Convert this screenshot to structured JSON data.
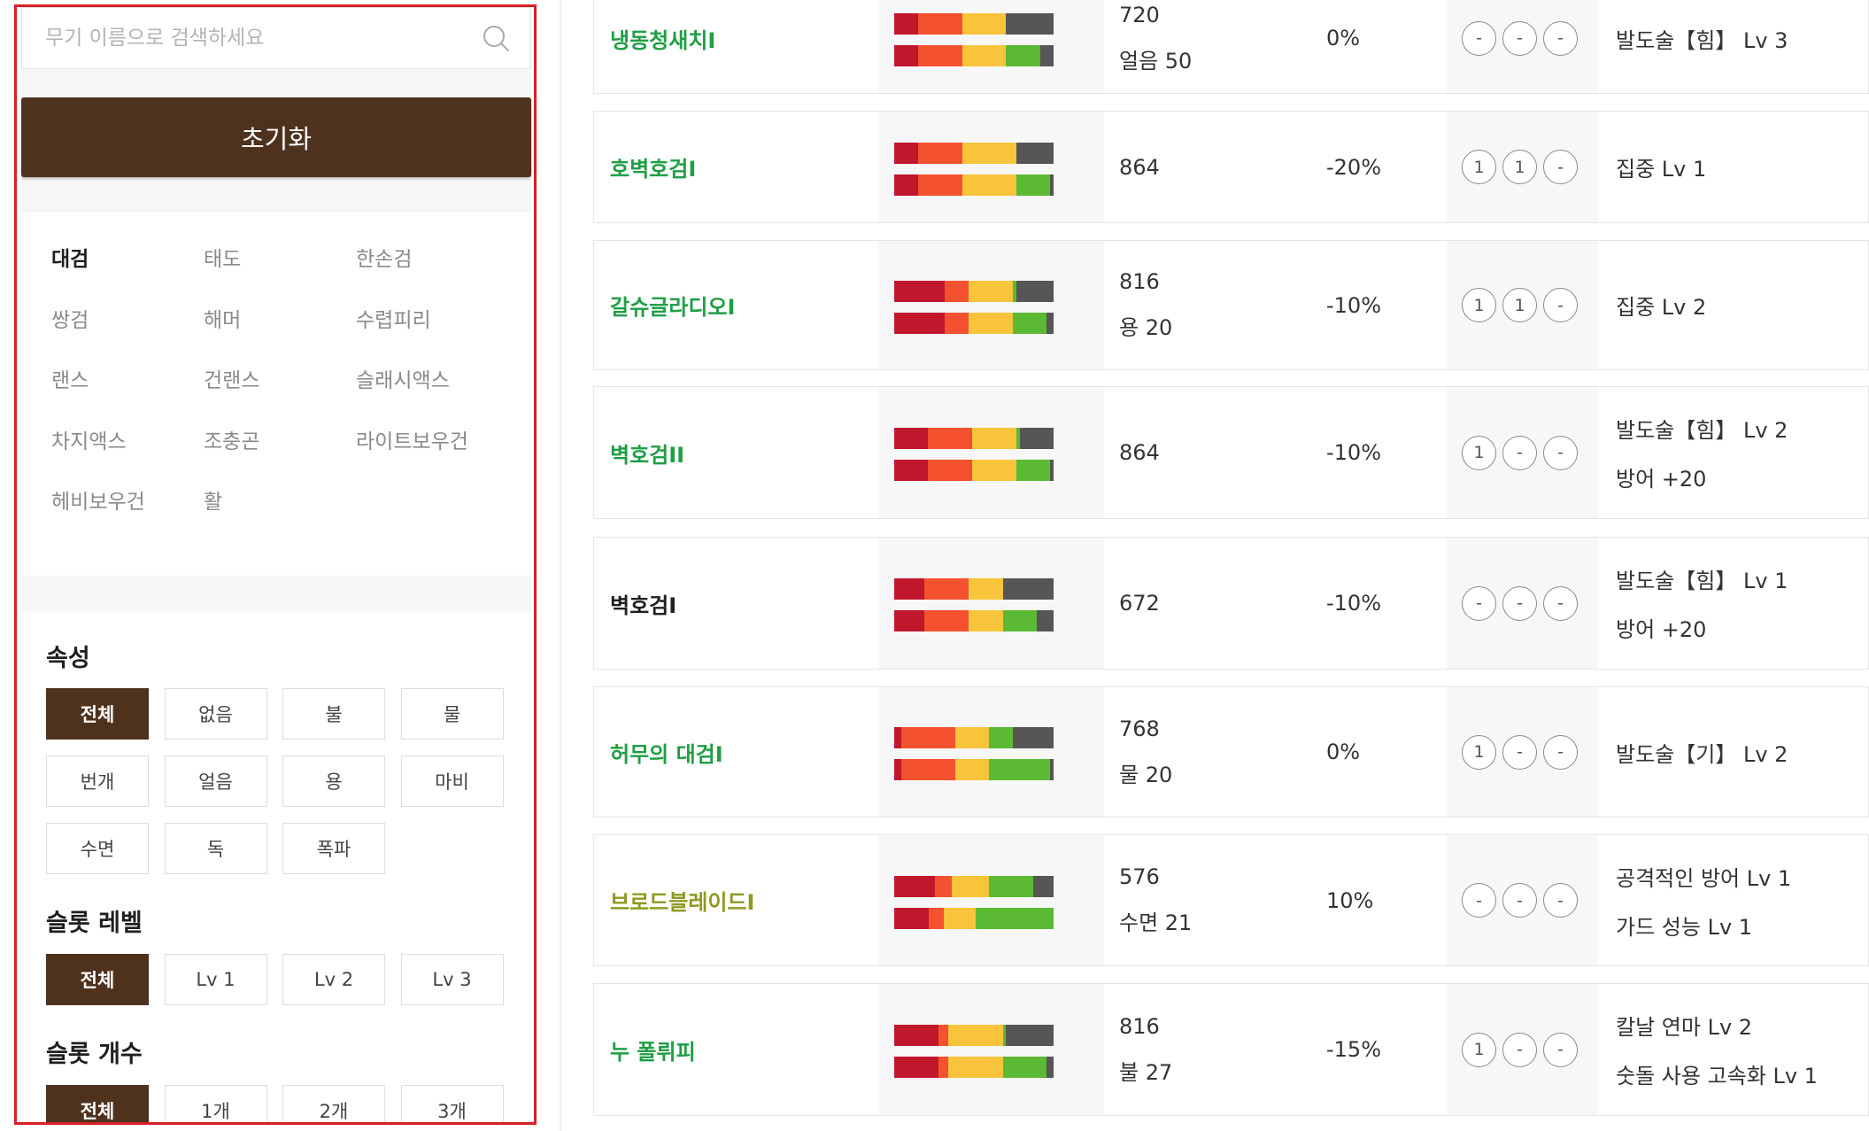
{
  "search": {
    "placeholder": "무기 이름으로 검색하세요",
    "value": ""
  },
  "reset_label": "초기화",
  "weapon_types": [
    {
      "label": "대검",
      "active": true
    },
    {
      "label": "태도",
      "active": false
    },
    {
      "label": "한손검",
      "active": false
    },
    {
      "label": "쌍검",
      "active": false
    },
    {
      "label": "해머",
      "active": false
    },
    {
      "label": "수렵피리",
      "active": false
    },
    {
      "label": "랜스",
      "active": false
    },
    {
      "label": "건랜스",
      "active": false
    },
    {
      "label": "슬래시액스",
      "active": false
    },
    {
      "label": "차지액스",
      "active": false
    },
    {
      "label": "조충곤",
      "active": false
    },
    {
      "label": "라이트보우건",
      "active": false
    },
    {
      "label": "헤비보우건",
      "active": false
    },
    {
      "label": "활",
      "active": false
    }
  ],
  "filters": {
    "element": {
      "title": "속성",
      "options": [
        "전체",
        "없음",
        "불",
        "물",
        "번개",
        "얼음",
        "용",
        "마비",
        "수면",
        "독",
        "폭파"
      ],
      "selected": "전체"
    },
    "slot_level": {
      "title": "슬롯 레벨",
      "options": [
        "전체",
        "Lv 1",
        "Lv 2",
        "Lv 3"
      ],
      "selected": "전체"
    },
    "slot_count": {
      "title": "슬롯 개수",
      "options": [
        "전체",
        "1개",
        "2개",
        "3개"
      ],
      "selected": "전체"
    }
  },
  "sharpness_colors": {
    "red": "#c0172c",
    "orange": "#f3512f",
    "yellow": "#f8c43c",
    "green": "#5cb933",
    "empty": "#565656"
  },
  "colors": {
    "accent_brown": "#4f321e",
    "name_green": "#1f9e45",
    "name_olive": "#8e9a20",
    "name_black": "#1f1f1f",
    "sidebar_border": "#d71f26"
  },
  "weapons": [
    {
      "name": "냉동청새치I",
      "name_color": "#1f9e45",
      "attack": "720",
      "element": "얼음 50",
      "affinity": "0%",
      "slots": [
        "-",
        "-",
        "-"
      ],
      "skills": [
        "발도술【힘】 Lv 3"
      ],
      "sharpness": [
        [
          7,
          13,
          13,
          0
        ],
        [
          7,
          13,
          13,
          10
        ]
      ]
    },
    {
      "name": "호벽호검I",
      "name_color": "#1f9e45",
      "attack": "864",
      "element": "",
      "affinity": "-20%",
      "slots": [
        "1",
        "1",
        "-"
      ],
      "skills": [
        "집중 Lv 1"
      ],
      "sharpness": [
        [
          7,
          13,
          16,
          0
        ],
        [
          7,
          13,
          16,
          10
        ]
      ]
    },
    {
      "name": "갈슈글라디오I",
      "name_color": "#1f9e45",
      "attack": "816",
      "element": "용 20",
      "affinity": "-10%",
      "slots": [
        "1",
        "1",
        "-"
      ],
      "skills": [
        "집중 Lv 2"
      ],
      "sharpness": [
        [
          15,
          7,
          13,
          1
        ],
        [
          15,
          7,
          13,
          10
        ]
      ]
    },
    {
      "name": "벽호검II",
      "name_color": "#1f9e45",
      "attack": "864",
      "element": "",
      "affinity": "-10%",
      "slots": [
        "1",
        "-",
        "-"
      ],
      "skills": [
        "발도술【힘】 Lv 2",
        "방어 +20"
      ],
      "sharpness": [
        [
          10,
          13,
          13,
          1
        ],
        [
          10,
          13,
          13,
          10
        ]
      ]
    },
    {
      "name": "벽호검I",
      "name_color": "#1f1f1f",
      "attack": "672",
      "element": "",
      "affinity": "-10%",
      "slots": [
        "-",
        "-",
        "-"
      ],
      "skills": [
        "발도술【힘】 Lv 1",
        "방어 +20"
      ],
      "sharpness": [
        [
          9,
          13,
          10,
          0
        ],
        [
          9,
          13,
          10,
          10
        ]
      ]
    },
    {
      "name": "허무의 대검I",
      "name_color": "#1f9e45",
      "attack": "768",
      "element": "물 20",
      "affinity": "0%",
      "slots": [
        "1",
        "-",
        "-"
      ],
      "skills": [
        "발도술【기】 Lv 2"
      ],
      "sharpness": [
        [
          2,
          16,
          10,
          7
        ],
        [
          2,
          16,
          10,
          18
        ]
      ]
    },
    {
      "name": "브로드블레이드I",
      "name_color": "#8e9a20",
      "attack": "576",
      "element": "수면 21",
      "affinity": "10%",
      "slots": [
        "-",
        "-",
        "-"
      ],
      "skills": [
        "공격적인 방어 Lv 1",
        "가드 성능 Lv 1"
      ],
      "sharpness": [
        [
          12,
          5,
          11,
          13
        ],
        [
          12,
          5,
          11,
          27
        ]
      ]
    },
    {
      "name": "누 폴뤼피",
      "name_color": "#1f9e45",
      "attack": "816",
      "element": "불 27",
      "affinity": "-15%",
      "slots": [
        "1",
        "-",
        "-"
      ],
      "skills": [
        "칼날 연마 Lv 2",
        "숫돌 사용 고속화 Lv 1"
      ],
      "sharpness": [
        [
          13,
          3,
          16,
          1
        ],
        [
          13,
          3,
          16,
          13
        ]
      ]
    }
  ]
}
